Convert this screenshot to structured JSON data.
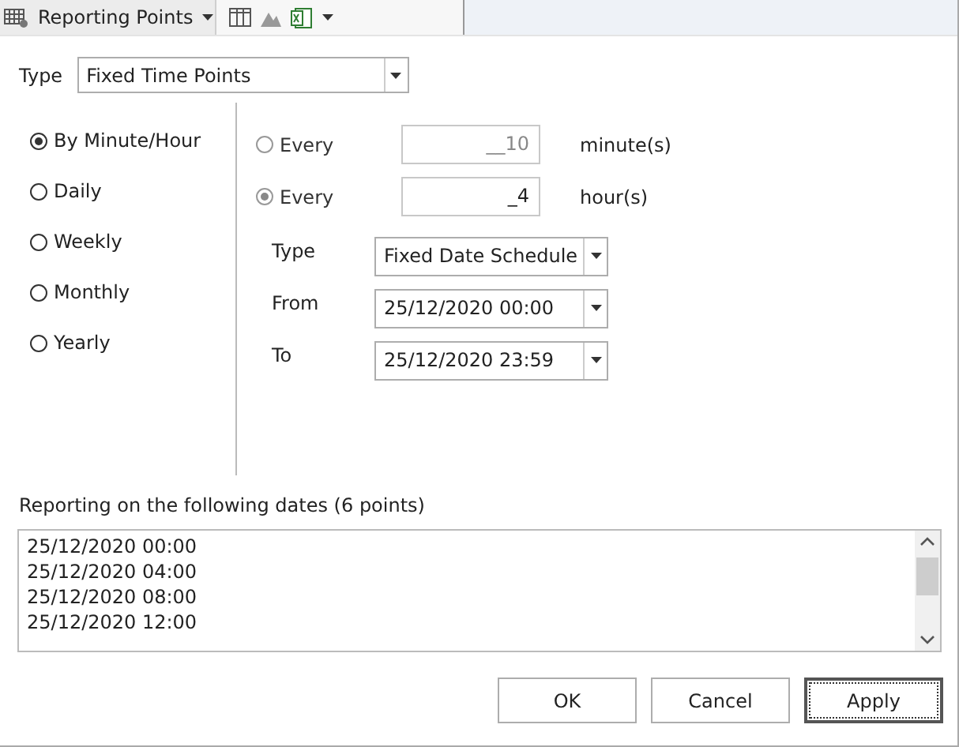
{
  "toolbar": {
    "title": "Reporting Points"
  },
  "type": {
    "label": "Type",
    "value": "Fixed Time Points"
  },
  "frequency": [
    {
      "label": "By Minute/Hour",
      "selected": true
    },
    {
      "label": "Daily",
      "selected": false
    },
    {
      "label": "Weekly",
      "selected": false
    },
    {
      "label": "Monthly",
      "selected": false
    },
    {
      "label": "Yearly",
      "selected": false
    }
  ],
  "intervals": [
    {
      "label": "Every",
      "value": "__10",
      "unit": "minute(s)",
      "selected": false
    },
    {
      "label": "Every",
      "value": "_4",
      "unit": "hour(s)",
      "selected": true
    }
  ],
  "schedule": [
    {
      "label": "Type",
      "value": "Fixed Date Schedule"
    },
    {
      "label": "From",
      "value": "25/12/2020 00:00"
    },
    {
      "label": "To",
      "value": "25/12/2020 23:59"
    }
  ],
  "dates_label": "Reporting on the following dates (6 points)",
  "dates": [
    "25/12/2020 00:00",
    "25/12/2020 04:00",
    "25/12/2020 08:00",
    "25/12/2020 12:00"
  ],
  "buttons": [
    {
      "label": "OK",
      "default": false
    },
    {
      "label": "Cancel",
      "default": false
    },
    {
      "label": "Apply",
      "default": true
    }
  ]
}
